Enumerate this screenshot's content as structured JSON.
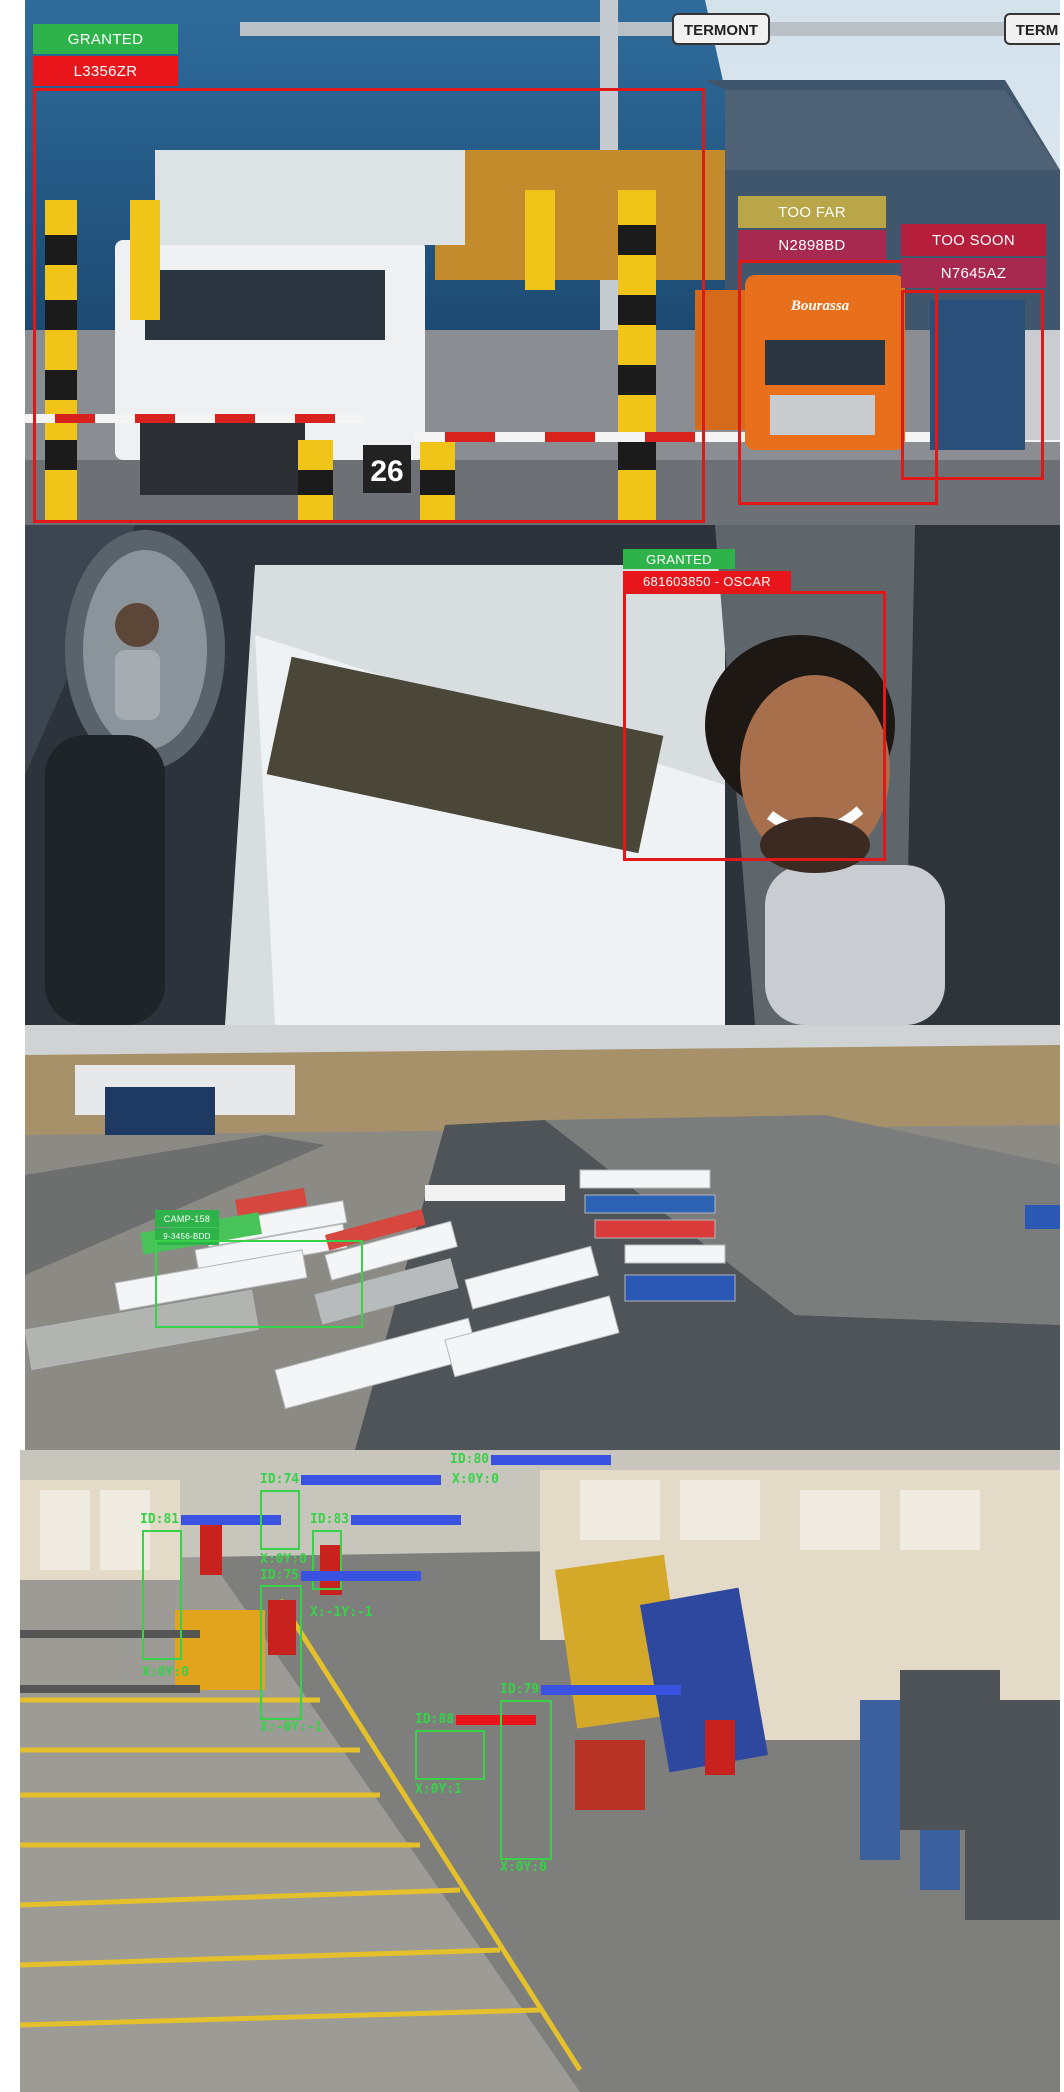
{
  "gate_panel": {
    "left_status": "GRANTED",
    "left_plate": "L3356ZR",
    "mid_status": "TOO FAR",
    "mid_plate": "N2898BD",
    "right_status": "TOO SOON",
    "right_plate": "N7645AZ",
    "sign_left": "TERMONT",
    "sign_right": "TERM",
    "lane_number": "26",
    "truck_brand": "Bourassa",
    "colors": {
      "granted": "#2db34a",
      "plate": "#e8161b",
      "too_far": "#b8a648",
      "mid_plate_bg": "#a8294f",
      "too_soon": "#b51f3c",
      "box": "#e01818"
    }
  },
  "cab_panel": {
    "status": "GRANTED",
    "driver_id": "681603850 - OSCAR"
  },
  "yard_panel": {
    "zone_label": "CAMP-158",
    "zone_plate": "9-3456-BDD"
  },
  "warehouse_panel": {
    "tracks": [
      {
        "id": "ID:81",
        "xy": "X:0Y:0"
      },
      {
        "id": "ID:74",
        "xy": "X:0Y:0"
      },
      {
        "id": "ID:83",
        "xy": "X:0Y:0"
      },
      {
        "id": "ID:75",
        "xy": "X:-0Y:-1"
      },
      {
        "id": "ID:88",
        "xy": "X:0Y:1"
      },
      {
        "id": "ID:79",
        "xy": "X:0Y:0"
      },
      {
        "id": "ID:80",
        "xy": "X:0Y:0"
      }
    ],
    "extra_xy": "X:-1Y:-1"
  }
}
